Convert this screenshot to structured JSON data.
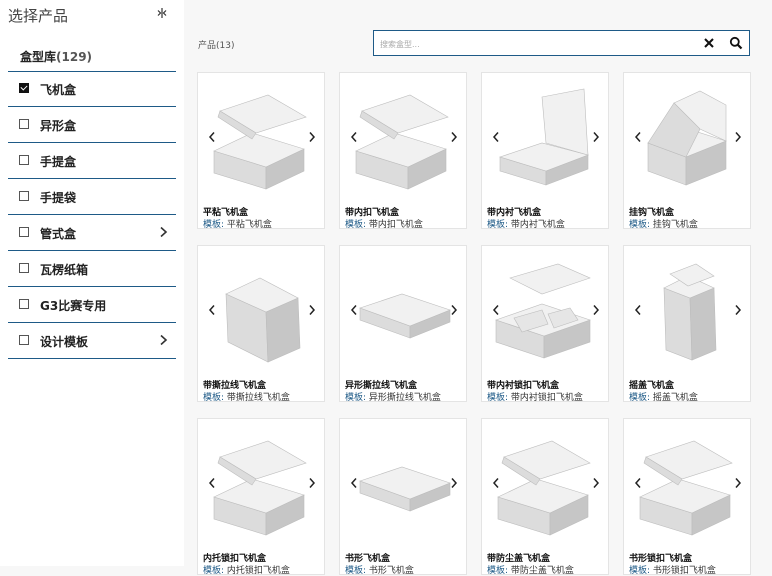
{
  "sidebar": {
    "title": "选择产品",
    "library_label": "盒型库",
    "library_count": "(129)",
    "categories": [
      {
        "label": "飞机盒",
        "checked": true,
        "has_children": false
      },
      {
        "label": "异形盒",
        "checked": false,
        "has_children": false
      },
      {
        "label": "手提盒",
        "checked": false,
        "has_children": false
      },
      {
        "label": "手提袋",
        "checked": false,
        "has_children": false
      },
      {
        "label": "管式盒",
        "checked": false,
        "has_children": true
      },
      {
        "label": "瓦楞纸箱",
        "checked": false,
        "has_children": false
      },
      {
        "label": "G3比赛专用",
        "checked": false,
        "has_children": false
      },
      {
        "label": "设计模板",
        "checked": false,
        "has_children": true
      }
    ]
  },
  "main": {
    "count_label": "产品(13)",
    "search": {
      "placeholder": "搜索盒型...",
      "value": ""
    },
    "template_prefix": "模板:",
    "products": [
      {
        "name": "平粘飞机盒",
        "template": "平粘飞机盒",
        "shape": "mailer"
      },
      {
        "name": "带内扣飞机盒",
        "template": "带内扣飞机盒",
        "shape": "mailer"
      },
      {
        "name": "带内衬飞机盒",
        "template": "带内衬飞机盒",
        "shape": "tray-open"
      },
      {
        "name": "挂钩飞机盒",
        "template": "挂钩飞机盒",
        "shape": "hook"
      },
      {
        "name": "带撕拉线飞机盒",
        "template": "带撕拉线飞机盒",
        "shape": "tall"
      },
      {
        "name": "异形撕拉线飞机盒",
        "template": "异形撕拉线飞机盒",
        "shape": "flat"
      },
      {
        "name": "带内衬锁扣飞机盒",
        "template": "带内衬锁扣飞机盒",
        "shape": "insert"
      },
      {
        "name": "摇盖飞机盒",
        "template": "摇盖飞机盒",
        "shape": "upright"
      },
      {
        "name": "内托锁扣飞机盒",
        "template": "内托锁扣飞机盒",
        "shape": "mailer"
      },
      {
        "name": "书形飞机盒",
        "template": "书形飞机盒",
        "shape": "flat"
      },
      {
        "name": "带防尘盖飞机盒",
        "template": "带防尘盖飞机盒",
        "shape": "mailer"
      },
      {
        "name": "书形锁扣飞机盒",
        "template": "书形锁扣飞机盒",
        "shape": "mailer"
      }
    ]
  },
  "icons": {
    "collapse": "collapse-sidebar-icon",
    "clear": "close-icon",
    "search": "search-icon",
    "prev": "chevron-left-icon",
    "next": "chevron-right-icon",
    "expand": "chevron-right-icon"
  },
  "colors": {
    "accent": "#1e5a87",
    "card_bg": "#ffffff",
    "page_bg": "#f7f7f7"
  }
}
